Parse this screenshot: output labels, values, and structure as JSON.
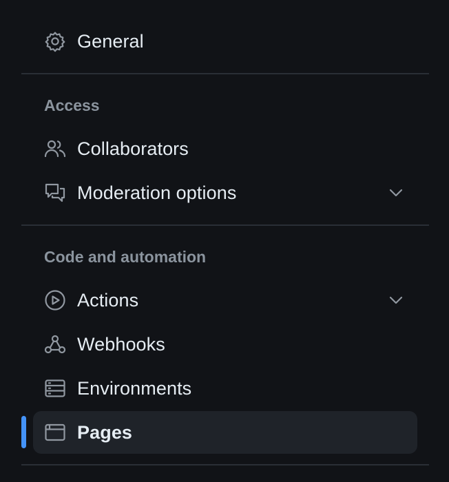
{
  "sidebar": {
    "general": {
      "label": "General",
      "icon": "gear-icon"
    },
    "access": {
      "heading": "Access",
      "items": [
        {
          "label": "Collaborators",
          "icon": "people-icon"
        },
        {
          "label": "Moderation options",
          "icon": "comment-discussion-icon",
          "expandable": true
        }
      ]
    },
    "code_automation": {
      "heading": "Code and automation",
      "items": [
        {
          "label": "Actions",
          "icon": "play-icon",
          "expandable": true
        },
        {
          "label": "Webhooks",
          "icon": "webhook-icon"
        },
        {
          "label": "Environments",
          "icon": "server-icon"
        },
        {
          "label": "Pages",
          "icon": "browser-icon",
          "selected": true
        }
      ]
    }
  },
  "colors": {
    "background": "#111317",
    "text": "#e6edf3",
    "muted": "#8b949e",
    "selected_bg": "#1f2329",
    "accent": "#4493f8",
    "divider": "#2a2f36"
  }
}
